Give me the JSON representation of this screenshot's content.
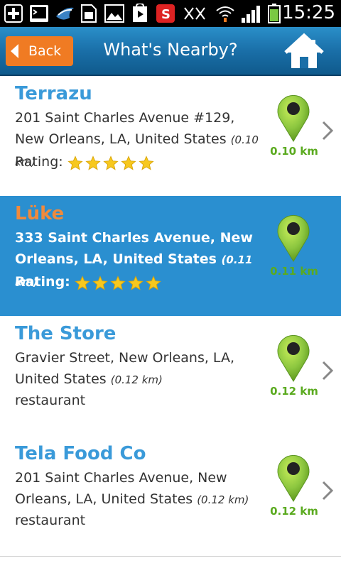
{
  "status_bar": {
    "time": "15:25",
    "icons": [
      "add-icon",
      "terminal-icon",
      "weather-icon",
      "sim-card-icon",
      "image-icon",
      "play-store-icon",
      "s-app-icon",
      "no-signal-icon",
      "wifi-icon",
      "signal-icon",
      "battery-icon"
    ]
  },
  "header": {
    "back_label": "Back",
    "title": "What's Nearby?",
    "home_icon": "home-icon"
  },
  "items": [
    {
      "name": "Terrazu",
      "address": "201 Saint Charles Avenue #129, New Orleans, LA, United States",
      "distance_inline": "(0.10 km)",
      "extra_type": "rating",
      "rating_label": "Rating:",
      "rating": 5,
      "distance": "0.10 km",
      "selected": false
    },
    {
      "name": "Lüke",
      "address": "333 Saint Charles Avenue, New Orleans, LA, United States",
      "distance_inline": "(0.11 km)",
      "extra_type": "rating",
      "rating_label": "Rating:",
      "rating": 5,
      "distance": "0.11 km",
      "selected": true
    },
    {
      "name": "The Store",
      "address": "Gravier Street, New Orleans, LA, United States",
      "distance_inline": "(0.12 km)",
      "extra_type": "category",
      "category": "restaurant",
      "distance": "0.12 km",
      "selected": false
    },
    {
      "name": "Tela Food Co",
      "address": "201 Saint Charles Avenue, New Orleans, LA, United States",
      "distance_inline": "(0.12 km)",
      "extra_type": "category",
      "category": "restaurant",
      "distance": "0.12 km",
      "selected": false
    }
  ],
  "colors": {
    "accent_blue": "#3a9ad9",
    "selected_bg": "#2a8fd0",
    "back_orange": "#f07b23",
    "pin_green": "#8cc63f",
    "distance_green": "#5aaa1f",
    "star_yellow": "#f7c81e"
  }
}
